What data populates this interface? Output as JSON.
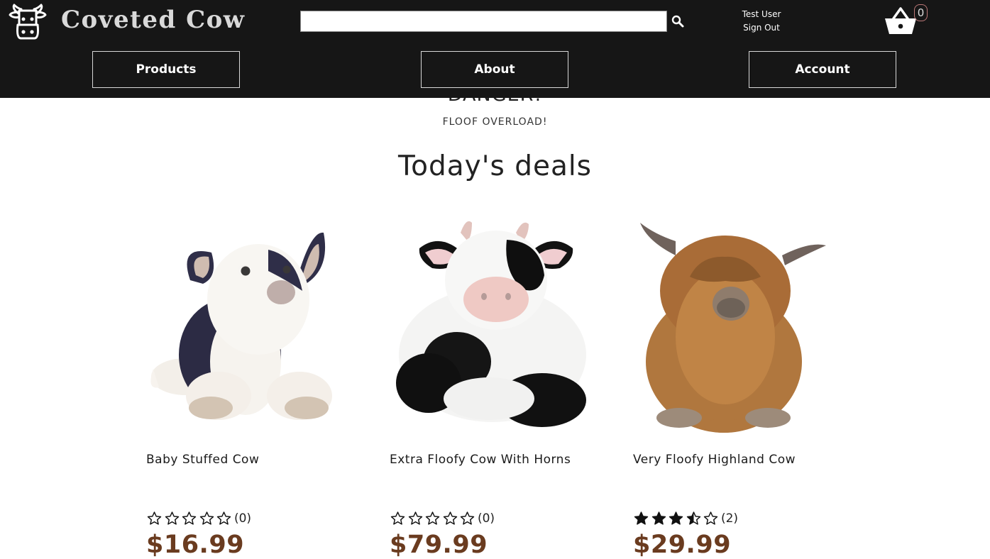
{
  "header": {
    "brand": "Coveted Cow",
    "logo_icon": "cow-head-icon",
    "search": {
      "value": "",
      "placeholder": "",
      "icon": "search-icon"
    },
    "user": {
      "name": "Test User",
      "sign_out": "Sign Out"
    },
    "cart": {
      "icon": "basket-icon",
      "count": "0"
    },
    "nav": [
      "Products",
      "About",
      "Account"
    ]
  },
  "hero": {
    "title": "DANGER!",
    "subtitle": "FLOOF OVERLOAD!"
  },
  "deals": {
    "title": "Today's deals",
    "products": [
      {
        "name": "Baby Stuffed Cow",
        "rating": 0,
        "reviews": "(0)",
        "price": "$16.99",
        "image": "baby-stuffed-cow"
      },
      {
        "name": "Extra Floofy Cow With Horns",
        "rating": 0,
        "reviews": "(0)",
        "price": "$79.99",
        "image": "floofy-cow-plush"
      },
      {
        "name": "Very Floofy Highland Cow",
        "rating": 3.5,
        "reviews": "(2)",
        "price": "$29.99",
        "image": "highland-cow-plush"
      }
    ]
  },
  "colors": {
    "header_bg": "#161616",
    "price": "#6a3b1f",
    "text": "#222222"
  }
}
